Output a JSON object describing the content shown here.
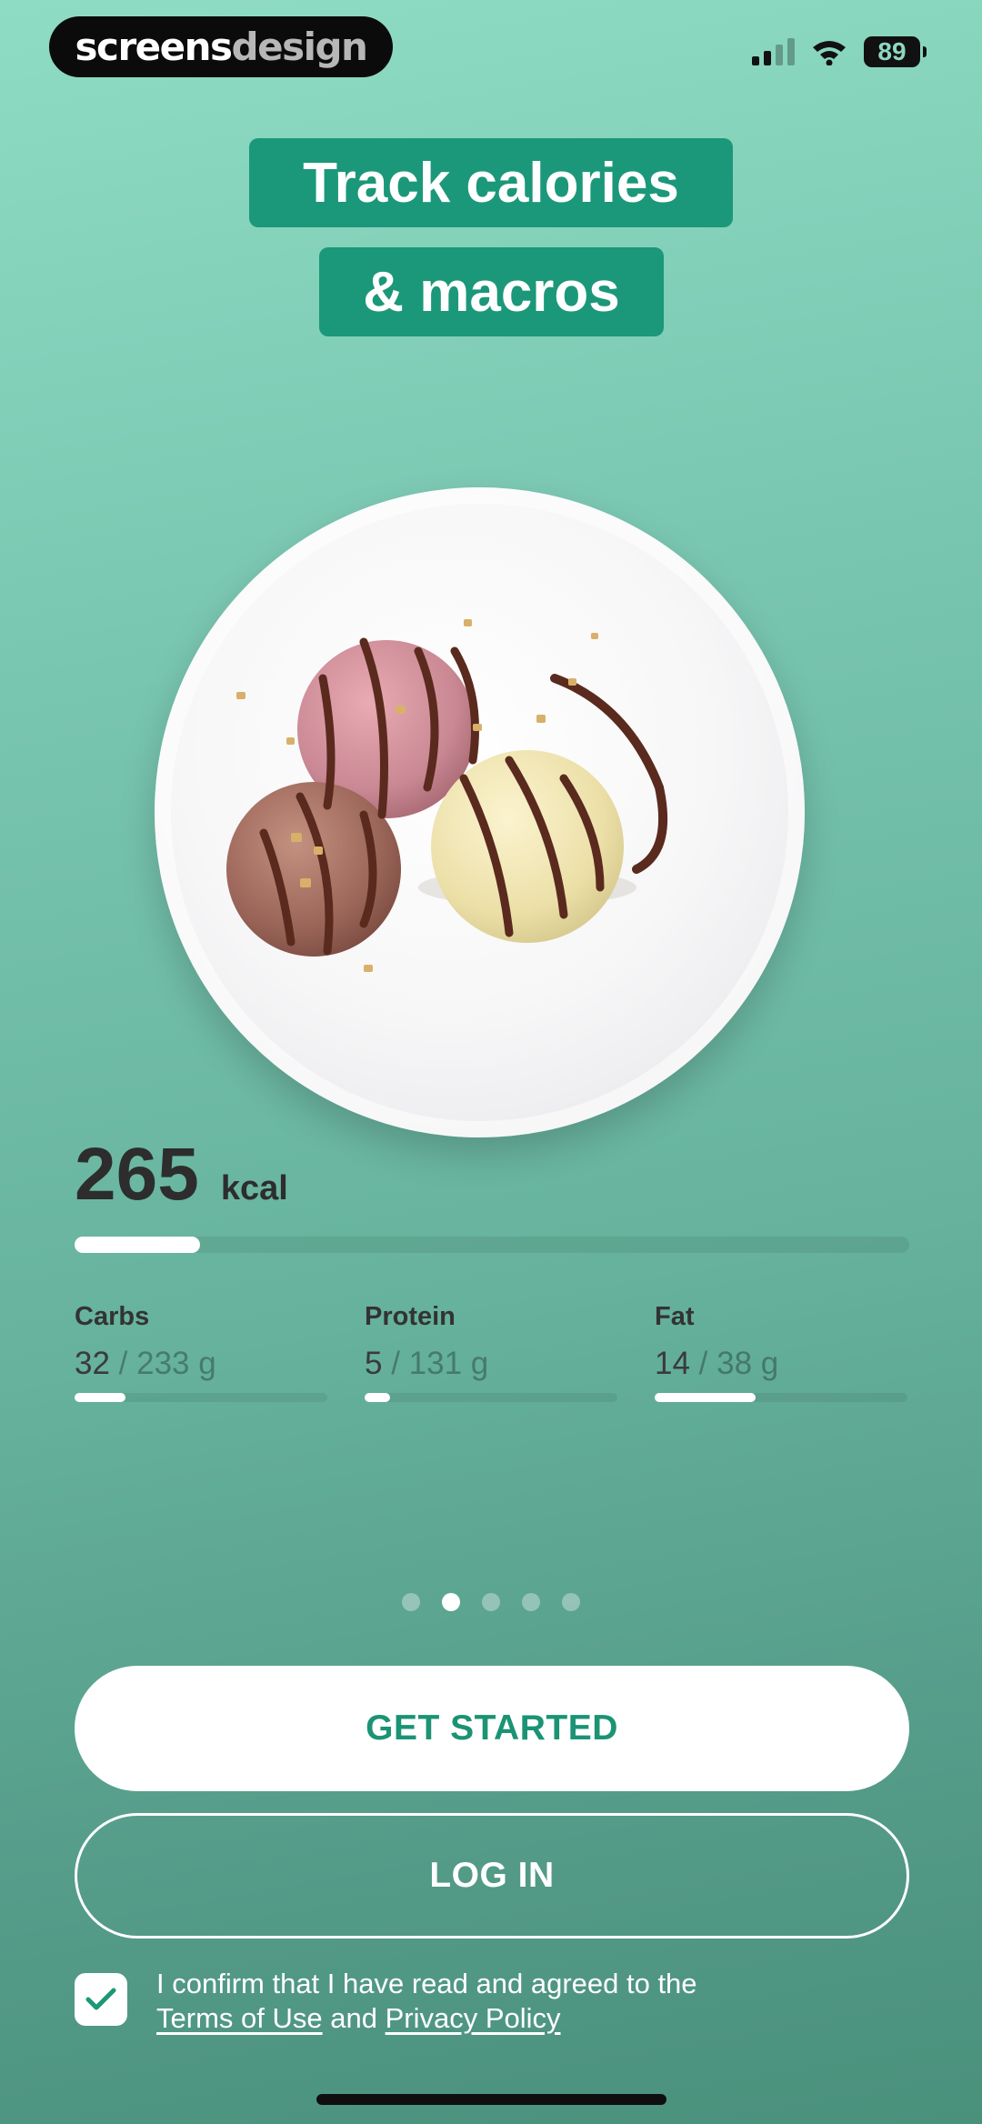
{
  "status_bar": {
    "brand_part1": "screens",
    "brand_part2": "design",
    "battery": "89",
    "icons": [
      "signal-icon",
      "wifi-icon",
      "battery-icon"
    ]
  },
  "title": {
    "line1": "Track calories",
    "line2": "& macros"
  },
  "hero_image": {
    "icon": "ice-cream-plate-image"
  },
  "calories": {
    "value": "265",
    "unit": "kcal",
    "progress": 0.15
  },
  "macros": [
    {
      "label": "Carbs",
      "current": "32",
      "goal": "/ 233 g",
      "progress": 0.2
    },
    {
      "label": "Protein",
      "current": "5",
      "goal": "/ 131 g",
      "progress": 0.1
    },
    {
      "label": "Fat",
      "current": "14",
      "goal": "/ 38 g",
      "progress": 0.4
    }
  ],
  "pagination": {
    "count": 5,
    "active_index": 1
  },
  "actions": {
    "get_started": "GET STARTED",
    "log_in": "LOG IN"
  },
  "consent": {
    "checked": true,
    "text": "I confirm that I have read and agreed to the",
    "terms": "Terms of Use",
    "and": "and",
    "privacy": "Privacy Policy"
  },
  "colors": {
    "accent": "#1b9879",
    "background_top": "#8fdcc4",
    "background_bottom": "#4a917c"
  }
}
